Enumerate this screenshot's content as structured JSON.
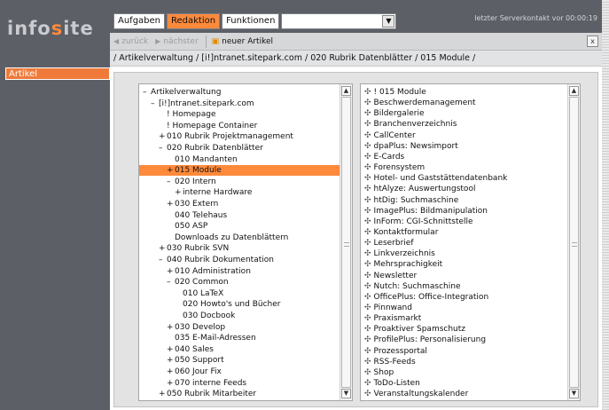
{
  "app": {
    "logo_prefix": "info",
    "logo_dot": "s",
    "logo_suffix": "ite",
    "server_status": "letzter Serverkontakt vor 00:00:19"
  },
  "menubar": {
    "items": [
      "Aufgaben",
      "Redaktion",
      "Funktionen"
    ],
    "active": "Redaktion",
    "select_value": ""
  },
  "sidebar": {
    "items": [
      "Artikel"
    ]
  },
  "navbar": {
    "back": "zurück",
    "next": "nächster",
    "new_article": "neuer Artikel",
    "close": "x"
  },
  "breadcrumb": "/ Artikelverwaltung / [i!]ntranet.sitepark.com / 020 Rubrik Datenblätter / 015 Module /",
  "tree": [
    {
      "pm": "–",
      "label": "Artikelverwaltung",
      "level": 0
    },
    {
      "pm": "–",
      "label": "[i!]ntranet.sitepark.com",
      "level": 1
    },
    {
      "pm": "",
      "label": "! Homepage",
      "level": 2
    },
    {
      "pm": "",
      "label": "! Homepage Container",
      "level": 2
    },
    {
      "pm": "+",
      "label": "010 Rubrik Projektmanagement",
      "level": 2
    },
    {
      "pm": "–",
      "label": "020 Rubrik Datenblätter",
      "level": 2
    },
    {
      "pm": "",
      "label": "010 Mandanten",
      "level": 3
    },
    {
      "pm": "+",
      "label": "015 Module",
      "level": 3,
      "selected": true
    },
    {
      "pm": "–",
      "label": "020 Intern",
      "level": 3
    },
    {
      "pm": "+",
      "label": "interne Hardware",
      "level": 4
    },
    {
      "pm": "+",
      "label": "030 Extern",
      "level": 3
    },
    {
      "pm": "",
      "label": "040 Telehaus",
      "level": 3
    },
    {
      "pm": "",
      "label": "050 ASP",
      "level": 3
    },
    {
      "pm": "",
      "label": "Downloads zu Datenblättern",
      "level": 3
    },
    {
      "pm": "+",
      "label": "030 Rubrik SVN",
      "level": 2
    },
    {
      "pm": "–",
      "label": "040 Rubrik Dokumentation",
      "level": 2
    },
    {
      "pm": "+",
      "label": "010 Administration",
      "level": 3
    },
    {
      "pm": "–",
      "label": "020 Common",
      "level": 3
    },
    {
      "pm": "",
      "label": "010 LaTeX",
      "level": 4
    },
    {
      "pm": "",
      "label": "020 Howto's und Bücher",
      "level": 4
    },
    {
      "pm": "",
      "label": "030 Docbook",
      "level": 4
    },
    {
      "pm": "+",
      "label": "030 Develop",
      "level": 3
    },
    {
      "pm": "",
      "label": "035 E-Mail-Adressen",
      "level": 3
    },
    {
      "pm": "+",
      "label": "040 Sales",
      "level": 3
    },
    {
      "pm": "+",
      "label": "050 Support",
      "level": 3
    },
    {
      "pm": "+",
      "label": "060 Jour Fix",
      "level": 3
    },
    {
      "pm": "+",
      "label": "070 interne Feeds",
      "level": 3
    },
    {
      "pm": "+",
      "label": "050 Rubrik Mitarbeiter",
      "level": 2
    }
  ],
  "modules": [
    "! 015 Module",
    "Beschwerdemanagement",
    "Bildergalerie",
    "Branchenverzeichnis",
    "CallCenter",
    "dpaPlus: Newsimport",
    "E-Cards",
    "Forensystem",
    "Hotel- und Gaststättendatenbank",
    "htAlyze: Auswertungstool",
    "htDig: Suchmaschine",
    "ImagePlus: Bildmanipulation",
    "InForm: CGI-Schnittstelle",
    "Kontaktformular",
    "Leserbrief",
    "Linkverzeichnis",
    "Mehrsprachigkeit",
    "Newsletter",
    "Nutch: Suchmaschine",
    "OfficePlus: Office-Integration",
    "Pinnwand",
    "Praxismarkt",
    "Proaktiver Spamschutz",
    "ProfilePlus: Personalisierung",
    "Prozessportal",
    "RSS-Feeds",
    "Shop",
    "ToDo-Listen",
    "Veranstaltungskalender"
  ],
  "colors": {
    "accent": "#ff8a3c",
    "chrome": "#5c5f66"
  },
  "icons": {
    "back": "triangle-left-icon",
    "next": "triangle-right-icon",
    "new": "new-document-icon",
    "module": "four-diamond-icon"
  }
}
